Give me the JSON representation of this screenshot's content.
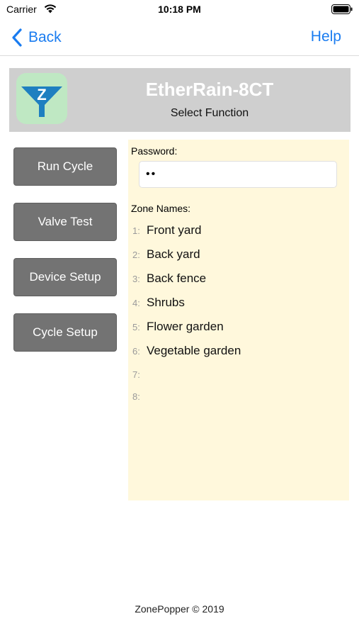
{
  "status_bar": {
    "carrier": "Carrier",
    "time": "10:18 PM"
  },
  "nav": {
    "back_label": "Back",
    "help_label": "Help",
    "accent_color": "#1a7cf0"
  },
  "header": {
    "device_name": "EtherRain-8CT",
    "subtitle": "Select Function",
    "logo_letter": "Z"
  },
  "functions": {
    "run_cycle": "Run Cycle",
    "valve_test": "Valve Test",
    "device_setup": "Device Setup",
    "cycle_setup": "Cycle Setup"
  },
  "panel": {
    "password_label": "Password:",
    "password_value": "••",
    "zone_names_label": "Zone Names:",
    "zones": [
      {
        "num": "1:",
        "name": "Front yard"
      },
      {
        "num": "2:",
        "name": "Back yard"
      },
      {
        "num": "3:",
        "name": "Back fence"
      },
      {
        "num": "4:",
        "name": "Shrubs"
      },
      {
        "num": "5:",
        "name": "Flower garden"
      },
      {
        "num": "6:",
        "name": "Vegetable garden"
      },
      {
        "num": "7:",
        "name": ""
      },
      {
        "num": "8:",
        "name": ""
      }
    ]
  },
  "footer": {
    "text": "ZonePopper © 2019"
  }
}
